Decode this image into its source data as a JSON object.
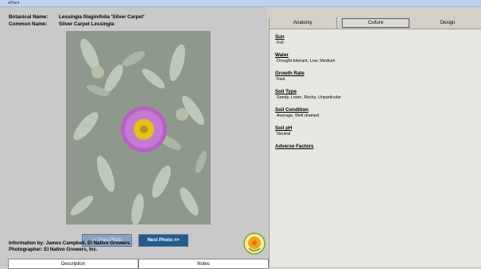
{
  "window": {
    "title_fragment": "ePlant"
  },
  "names": {
    "botanical_label": "Botanical Name:",
    "botanical_value": "Lessingia filaginifolia 'Silver Carpet'",
    "common_label": "Common Name:",
    "common_value": "Silver Carpet Lessingia"
  },
  "nav": {
    "prev_label": "<< Prev Photo",
    "next_label": "Next Photo >>"
  },
  "credits": {
    "info_line": "Information by: James Campbell, El Nativo Growers",
    "photo_line": "Photographer: El Nativo Growers, Inc."
  },
  "bottom_tabs": [
    {
      "label": "Description"
    },
    {
      "label": "Notes"
    }
  ],
  "tabs": [
    {
      "label": "Anatomy"
    },
    {
      "label": "Culture"
    },
    {
      "label": "Design"
    }
  ],
  "culture": {
    "sun_label": "Sun",
    "sun_value": "Full",
    "water_label": "Water",
    "water_value": "Drought tolerant, Low, Medium",
    "growth_label": "Growth Rate",
    "growth_value": "Fast",
    "soil_type_label": "Soil Type",
    "soil_type_value": "Sandy, Loam, Rocky, Unparticular",
    "soil_condition_label": "Soil Condition",
    "soil_condition_value": "Average, Well drained",
    "soil_ph_label": "Soil pH",
    "soil_ph_value": "Neutral",
    "adverse_label": "Adverse Factors"
  },
  "colors": {
    "accent": "#235b8f",
    "flower": "#b760c4",
    "center": "#e0c318"
  }
}
